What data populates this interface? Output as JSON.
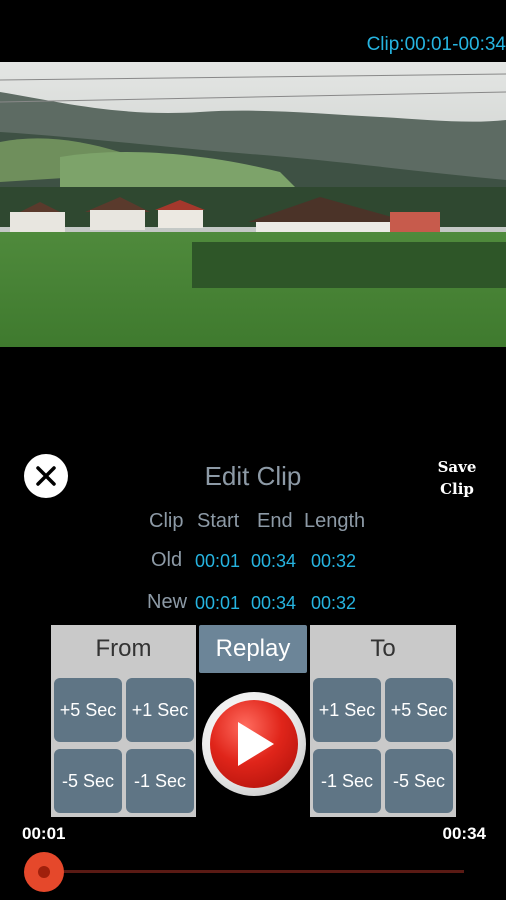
{
  "header": {
    "clip_range": "Clip:00:01-00:34"
  },
  "video": {
    "icon": "video-frame-landscape"
  },
  "editor": {
    "title": "Edit Clip",
    "close_icon": "close-icon",
    "save_label_line1": "Save",
    "save_label_line2": "Clip"
  },
  "clip_info": {
    "headers": [
      "Clip",
      "Start",
      "End",
      "Length"
    ],
    "old": {
      "label": "Old",
      "start": "00:01",
      "end": "00:34",
      "length": "00:32"
    },
    "new": {
      "label": "New",
      "start": "00:01",
      "end": "00:34",
      "length": "00:32"
    }
  },
  "controls": {
    "from_label": "From",
    "replay_label": "Replay",
    "to_label": "To",
    "from_buttons": [
      "+5 Sec",
      "+1 Sec",
      "-5 Sec",
      "-1 Sec"
    ],
    "to_buttons": [
      "+1 Sec",
      "+5 Sec",
      "-1 Sec",
      "-5 Sec"
    ],
    "play_icon": "play-icon"
  },
  "seekbar": {
    "start_time": "00:01",
    "end_time": "00:34",
    "progress": 0.0
  },
  "colors": {
    "accent": "#26b4e0",
    "button": "#5f7585",
    "play": "#e0251a",
    "seek": "#e5482b"
  }
}
